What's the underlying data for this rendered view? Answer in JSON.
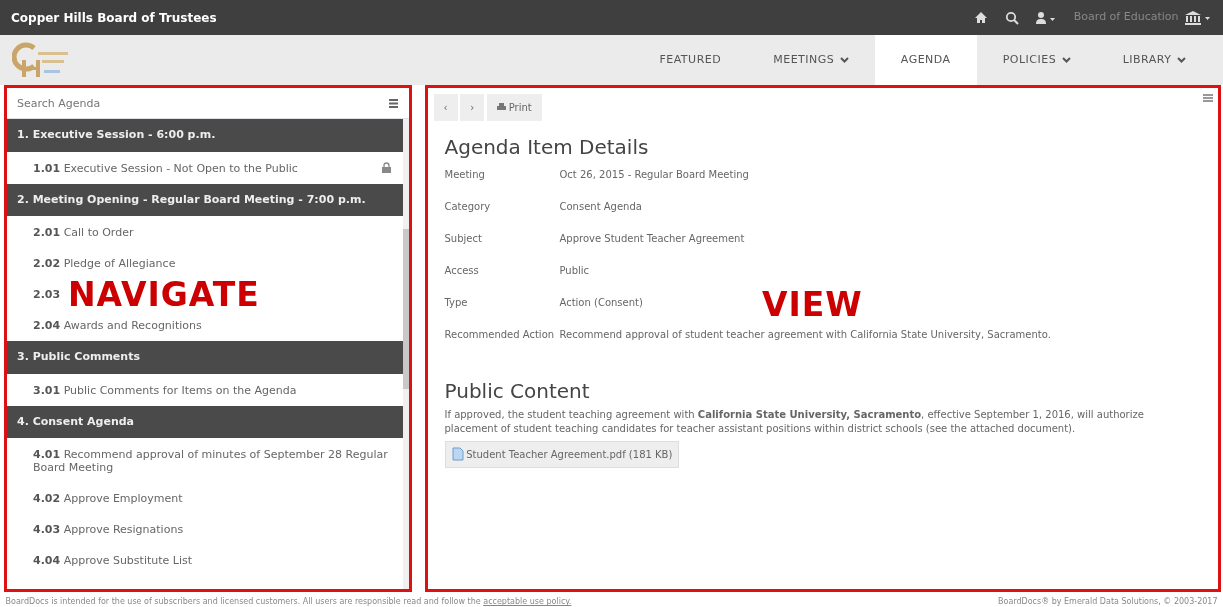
{
  "top_bar": {
    "title": "Copper Hills Board of Trustees",
    "account": "Board of Education"
  },
  "nav": {
    "items": [
      {
        "label": "FEATURED",
        "selected": false,
        "dropdown": false
      },
      {
        "label": "MEETINGS",
        "selected": false,
        "dropdown": true
      },
      {
        "label": "AGENDA",
        "selected": true,
        "dropdown": false
      },
      {
        "label": "POLICIES",
        "selected": false,
        "dropdown": true
      },
      {
        "label": "LIBRARY",
        "selected": false,
        "dropdown": true
      }
    ]
  },
  "agenda": {
    "search": {
      "placeholder": "Search Agenda"
    },
    "sections": [
      {
        "title": "1. Executive Session - 6:00 p.m.",
        "items": [
          {
            "number": "1.01",
            "title": "Executive Session - Not Open to the Public",
            "locked": true
          }
        ]
      },
      {
        "title": "2. Meeting Opening - Regular Board Meeting - 7:00 p.m.",
        "items": [
          {
            "number": "2.01",
            "title": "Call to Order",
            "locked": false
          },
          {
            "number": "2.02",
            "title": "Pledge of Allegiance",
            "locked": false
          },
          {
            "number": "2.03",
            "locked": false
          },
          {
            "number": "2.04",
            "title": "Awards and Recognitions",
            "locked": false
          }
        ]
      },
      {
        "title": "3. Public Comments",
        "items": [
          {
            "number": "3.01",
            "title": "Public Comments for Items on the Agenda",
            "locked": false
          }
        ]
      },
      {
        "title": "4. Consent Agenda",
        "items": [
          {
            "number": "4.01",
            "title": "Recommend approval of minutes of September 28 Regular Board Meeting",
            "locked": false
          },
          {
            "number": "4.02",
            "title": "Approve Employment",
            "locked": false
          },
          {
            "number": "4.03",
            "title": "Approve Resignations",
            "locked": false
          },
          {
            "number": "4.04",
            "title": "Approve Substitute List",
            "locked": false
          }
        ]
      }
    ]
  },
  "detail": {
    "toolbar": {
      "previous": "‹",
      "next": "›",
      "print": "Print"
    },
    "heading": "Agenda Item Details",
    "fields": [
      {
        "label": "Meeting",
        "value": "Oct 26, 2015 - Regular Board Meeting"
      },
      {
        "label": "Category",
        "value": "Consent Agenda"
      },
      {
        "label": "Subject",
        "value": "Approve Student Teacher Agreement"
      },
      {
        "label": "Access",
        "value": "Public"
      },
      {
        "label": "Type",
        "value": "Action (Consent)"
      },
      {
        "label": "Recommended Action",
        "value": "Recommend approval of student teacher agreement with California State University, Sacramento."
      }
    ],
    "public_content": {
      "heading": "Public Content",
      "body": "If approved, the student teaching agreement with **California State University, Sacramento**, effective September 1, 2016, will authorize placement of student teaching candidates for teacher assistant positions within district schools (see the attached document).",
      "attachment": "Student Teacher Agreement.pdf (181 KB)"
    }
  },
  "annotations": [
    {
      "label": "NAVIGATE"
    },
    {
      "label": "VIEW"
    }
  ],
  "footer": {
    "notice": "BoardDocs is intended for the use of subscribers and licensed customers. All users are responsible read and follow the",
    "link": "acceptable use policy.",
    "copyright": "BoardDocs® by Emerald Data Solutions, © 2003-2017"
  }
}
